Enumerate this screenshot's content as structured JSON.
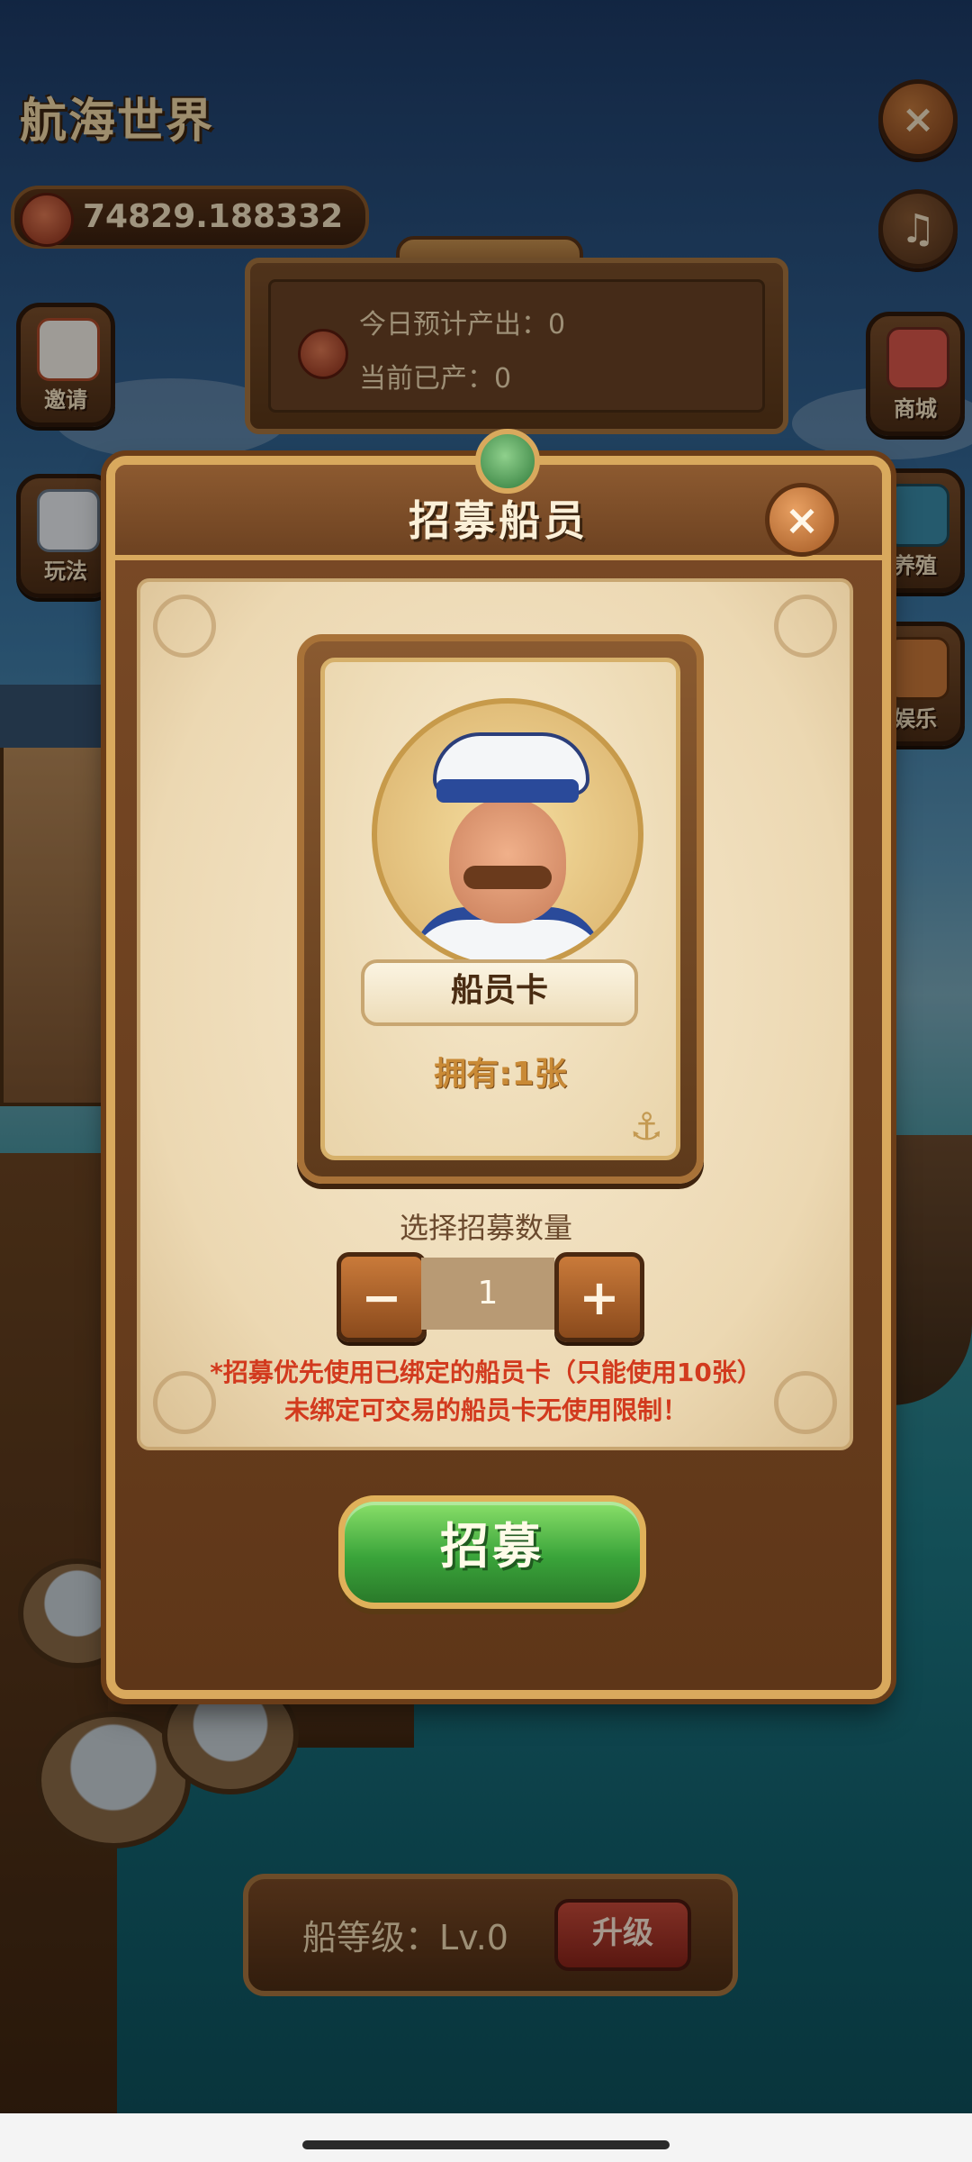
{
  "hud": {
    "title": "航海世界",
    "coins": "74829.188332",
    "close_icon": "×",
    "music_icon": "♫"
  },
  "stats": {
    "today_expected": "今日预计产出：0",
    "produced": "当前已产：0"
  },
  "left_menu": [
    {
      "label": "邀请",
      "icon": "envelope-icon"
    },
    {
      "label": "玩法",
      "icon": "gamepad-icon"
    }
  ],
  "right_menu": [
    {
      "label": "商城",
      "icon": "shop-icon"
    },
    {
      "label": "养殖",
      "icon": "fish-tank-icon"
    },
    {
      "label": "娱乐",
      "icon": "entertainment-icon"
    }
  ],
  "modal": {
    "title": "招募船员",
    "close": "×",
    "card_name": "船员卡",
    "owned": "拥有:1张",
    "select_label": "选择招募数量",
    "minus": "−",
    "plus": "+",
    "quantity": "1",
    "note_line1": "*招募优先使用已绑定的船员卡（只能使用10张）",
    "note_line2": "未绑定可交易的船员卡无使用限制！",
    "recruit": "招募"
  },
  "ship": {
    "level": "船等级：Lv.0",
    "upgrade": "升级"
  },
  "colors": {
    "accent_gold": "#d9a95d",
    "wood": "#7a4a26",
    "green_button": "#3aa43a",
    "warning_red": "#d23a1e"
  }
}
